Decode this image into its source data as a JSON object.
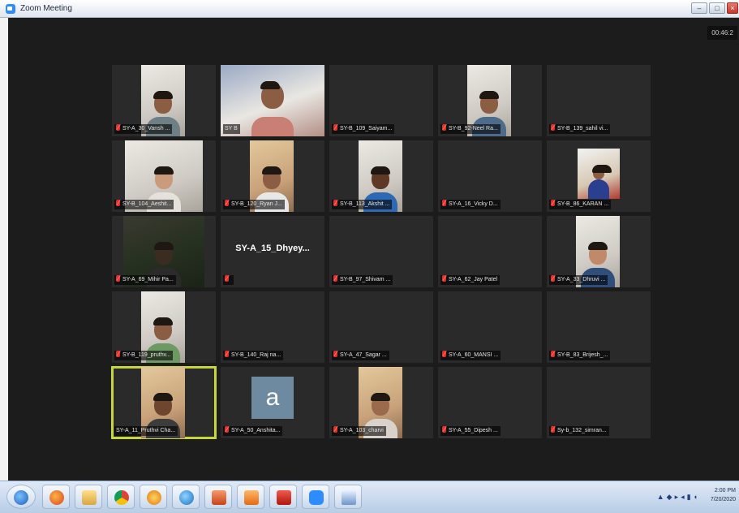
{
  "window": {
    "title": "Zoom Meeting"
  },
  "meeting": {
    "timer": "00:46:2"
  },
  "participants": [
    {
      "name": "SY-A_30_Vansh ..."
    },
    {
      "name": "SY B"
    },
    {
      "name": "SY-B_109_Saiyam..."
    },
    {
      "name": "SY-B_92-Neel Ra..."
    },
    {
      "name": "SY-B_139_sahil vi..."
    },
    {
      "name": "SY-B_104_Aeshit..."
    },
    {
      "name": "SY-B_120_Ryan J..."
    },
    {
      "name": "SY-B_113_Akshit ..."
    },
    {
      "name": "SY-A_16_Vicky D..."
    },
    {
      "name": "SY-B_86_KARAN ..."
    },
    {
      "name": "SY-A_69_Mihir Pa..."
    },
    {
      "name": "",
      "display": "SY-A_15_Dhyey..."
    },
    {
      "name": "SY-B_97_Shivam ..."
    },
    {
      "name": "SY-A_62_Jay Patel"
    },
    {
      "name": "SY-A_33_Dhruvi ..."
    },
    {
      "name": "SY-B_119_pruthv..."
    },
    {
      "name": "SY-B_140_Raj na..."
    },
    {
      "name": "SY-A_47_Sagar ..."
    },
    {
      "name": "SY-A_60_MANSI ..."
    },
    {
      "name": "SY-B_83_Brijesh_..."
    },
    {
      "name": "SY-A_11_Pruthvi Cha..."
    },
    {
      "name": "SY-A_50_Anshita...",
      "avatar_letter": "a"
    },
    {
      "name": "SY-A_103_charvi"
    },
    {
      "name": "SY-A_55_Dipesh ..."
    },
    {
      "name": "Sy-b_132_simran..."
    }
  ],
  "taskbar": {
    "time": "2:00 PM",
    "date": "7/20/2020"
  },
  "colors": {
    "active_speaker": "#c6d63b",
    "muted_icon": "#e0312a",
    "zoom_blue": "#2d8cff"
  }
}
